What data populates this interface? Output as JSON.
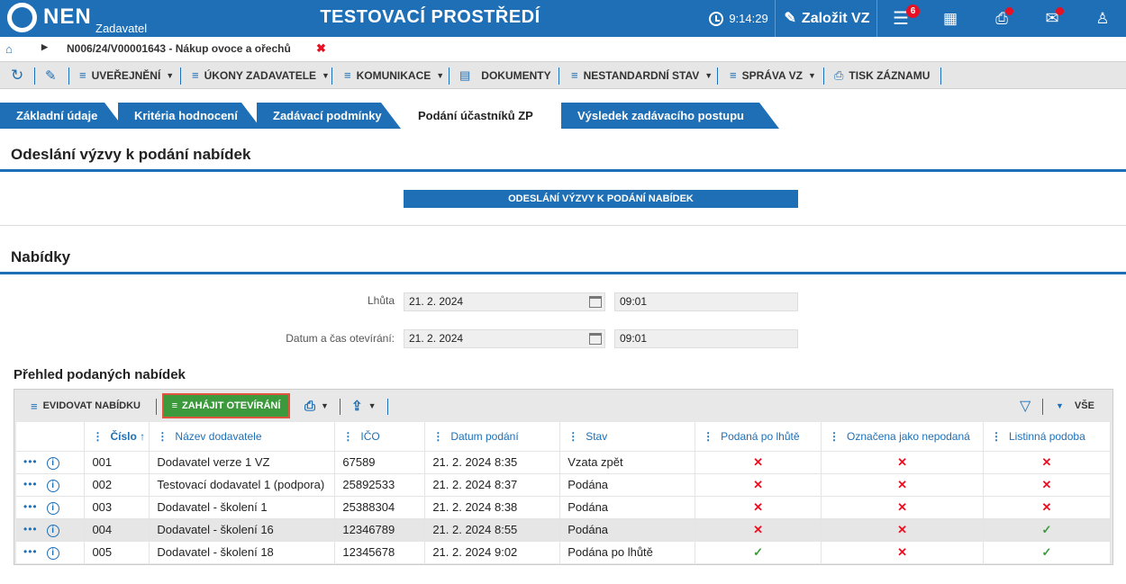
{
  "header": {
    "logo": "NEN",
    "logo_sub": "Zadavatel",
    "title": "TESTOVACÍ PROSTŘEDÍ",
    "time": "9:14:29",
    "create_label": "Založit VZ",
    "menu_badge": "6"
  },
  "breadcrumb": {
    "text": "N006/24/V00001643 - Nákup ovoce a ořechů"
  },
  "menubar": {
    "items": [
      "UVEŘEJNĚNÍ",
      "ÚKONY ZADAVATELE",
      "KOMUNIKACE",
      "DOKUMENTY",
      "NESTANDARDNÍ STAV",
      "SPRÁVA VZ",
      "TISK ZÁZNAMU"
    ]
  },
  "tabs": [
    "Základní údaje",
    "Kritéria hodnocení",
    "Zadávací podmínky",
    "Podání účastníků ZP",
    "Výsledek zadávacího postupu"
  ],
  "invite": {
    "title": "Odeslání výzvy k podání nabídek",
    "button": "ODESLÁNÍ VÝZVY K PODÁNÍ NABÍDEK"
  },
  "offers": {
    "title": "Nabídky",
    "deadline_label": "Lhůta",
    "deadline_date": "21. 2. 2024",
    "deadline_time": "09:01",
    "opening_label": "Datum a čas otevírání:",
    "opening_date": "21. 2. 2024",
    "opening_time": "09:01"
  },
  "grid": {
    "title": "Přehled podaných nabídek",
    "toolbar": {
      "register": "EVIDOVAT NABÍDKU",
      "start_opening": "ZAHÁJIT OTEVÍRÁNÍ",
      "filter_all": "VŠE"
    },
    "columns": [
      "Číslo",
      "Název dodavatele",
      "IČO",
      "Datum podání",
      "Stav",
      "Podaná po lhůtě",
      "Označena jako nepodaná",
      "Listinná podoba"
    ],
    "rows": [
      {
        "num": "001",
        "name": "Dodavatel verze 1 VZ",
        "ico": "67589",
        "date": "21. 2. 2024 8:35",
        "state": "Vzata zpět",
        "late": false,
        "unsubmitted": false,
        "paper": false
      },
      {
        "num": "002",
        "name": "Testovací dodavatel 1 (podpora)",
        "ico": "25892533",
        "date": "21. 2. 2024 8:37",
        "state": "Podána",
        "late": false,
        "unsubmitted": false,
        "paper": false
      },
      {
        "num": "003",
        "name": "Dodavatel - školení 1",
        "ico": "25388304",
        "date": "21. 2. 2024 8:38",
        "state": "Podána",
        "late": false,
        "unsubmitted": false,
        "paper": false
      },
      {
        "num": "004",
        "name": "Dodavatel - školení 16",
        "ico": "12346789",
        "date": "21. 2. 2024 8:55",
        "state": "Podána",
        "late": false,
        "unsubmitted": false,
        "paper": true
      },
      {
        "num": "005",
        "name": "Dodavatel - školení 18",
        "ico": "12345678",
        "date": "21. 2. 2024 9:02",
        "state": "Podána po lhůtě",
        "late": true,
        "unsubmitted": false,
        "paper": true
      }
    ]
  }
}
